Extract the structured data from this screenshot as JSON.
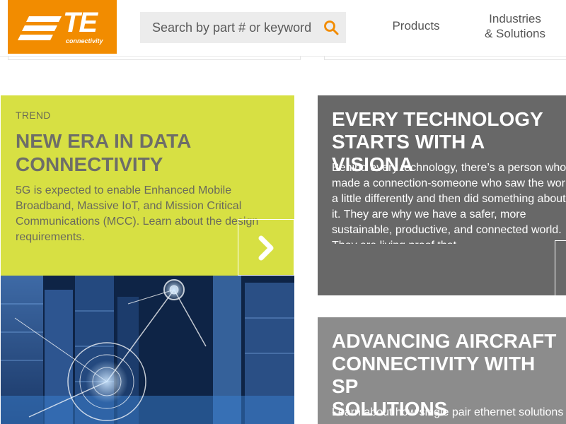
{
  "header": {
    "logo": {
      "mark": "TE",
      "tagline": "connectivity"
    },
    "search": {
      "placeholder": "Search by part # or keyword",
      "icon": "search-icon"
    },
    "nav": [
      {
        "label": "Products"
      },
      {
        "label": "Industries\n& Solutions"
      }
    ]
  },
  "trend_card": {
    "eyebrow": "TREND",
    "title": "NEW ERA IN DATA CONNECTIVITY",
    "body": "5G is expected to enable Enhanced Mobile Broadband, Massive IoT, and Mission Critical Communications (MCC). Learn about the design requirements.",
    "arrow_icon": "chevron-right-icon"
  },
  "vision_card": {
    "title": "EVERY TECHNOLOGY\nSTARTS WITH A VISIONA",
    "body": "Behind every technology, there’s a person who made a connection-someone who saw the world a little differently and then did something about it. They are why we have a safer, more sustainable, productive, and connected world. They are living proof that"
  },
  "aircraft_card": {
    "title": "ADVANCING AIRCRAFT\nCONNECTIVITY WITH SP\nSOLUTIONS",
    "body": "Learn about how single pair ethernet solutions"
  },
  "colors": {
    "brand_orange": "#f28c00",
    "trend_lime": "#d7e043",
    "card_dark": "#686868",
    "card_light": "#8c8c8c"
  }
}
